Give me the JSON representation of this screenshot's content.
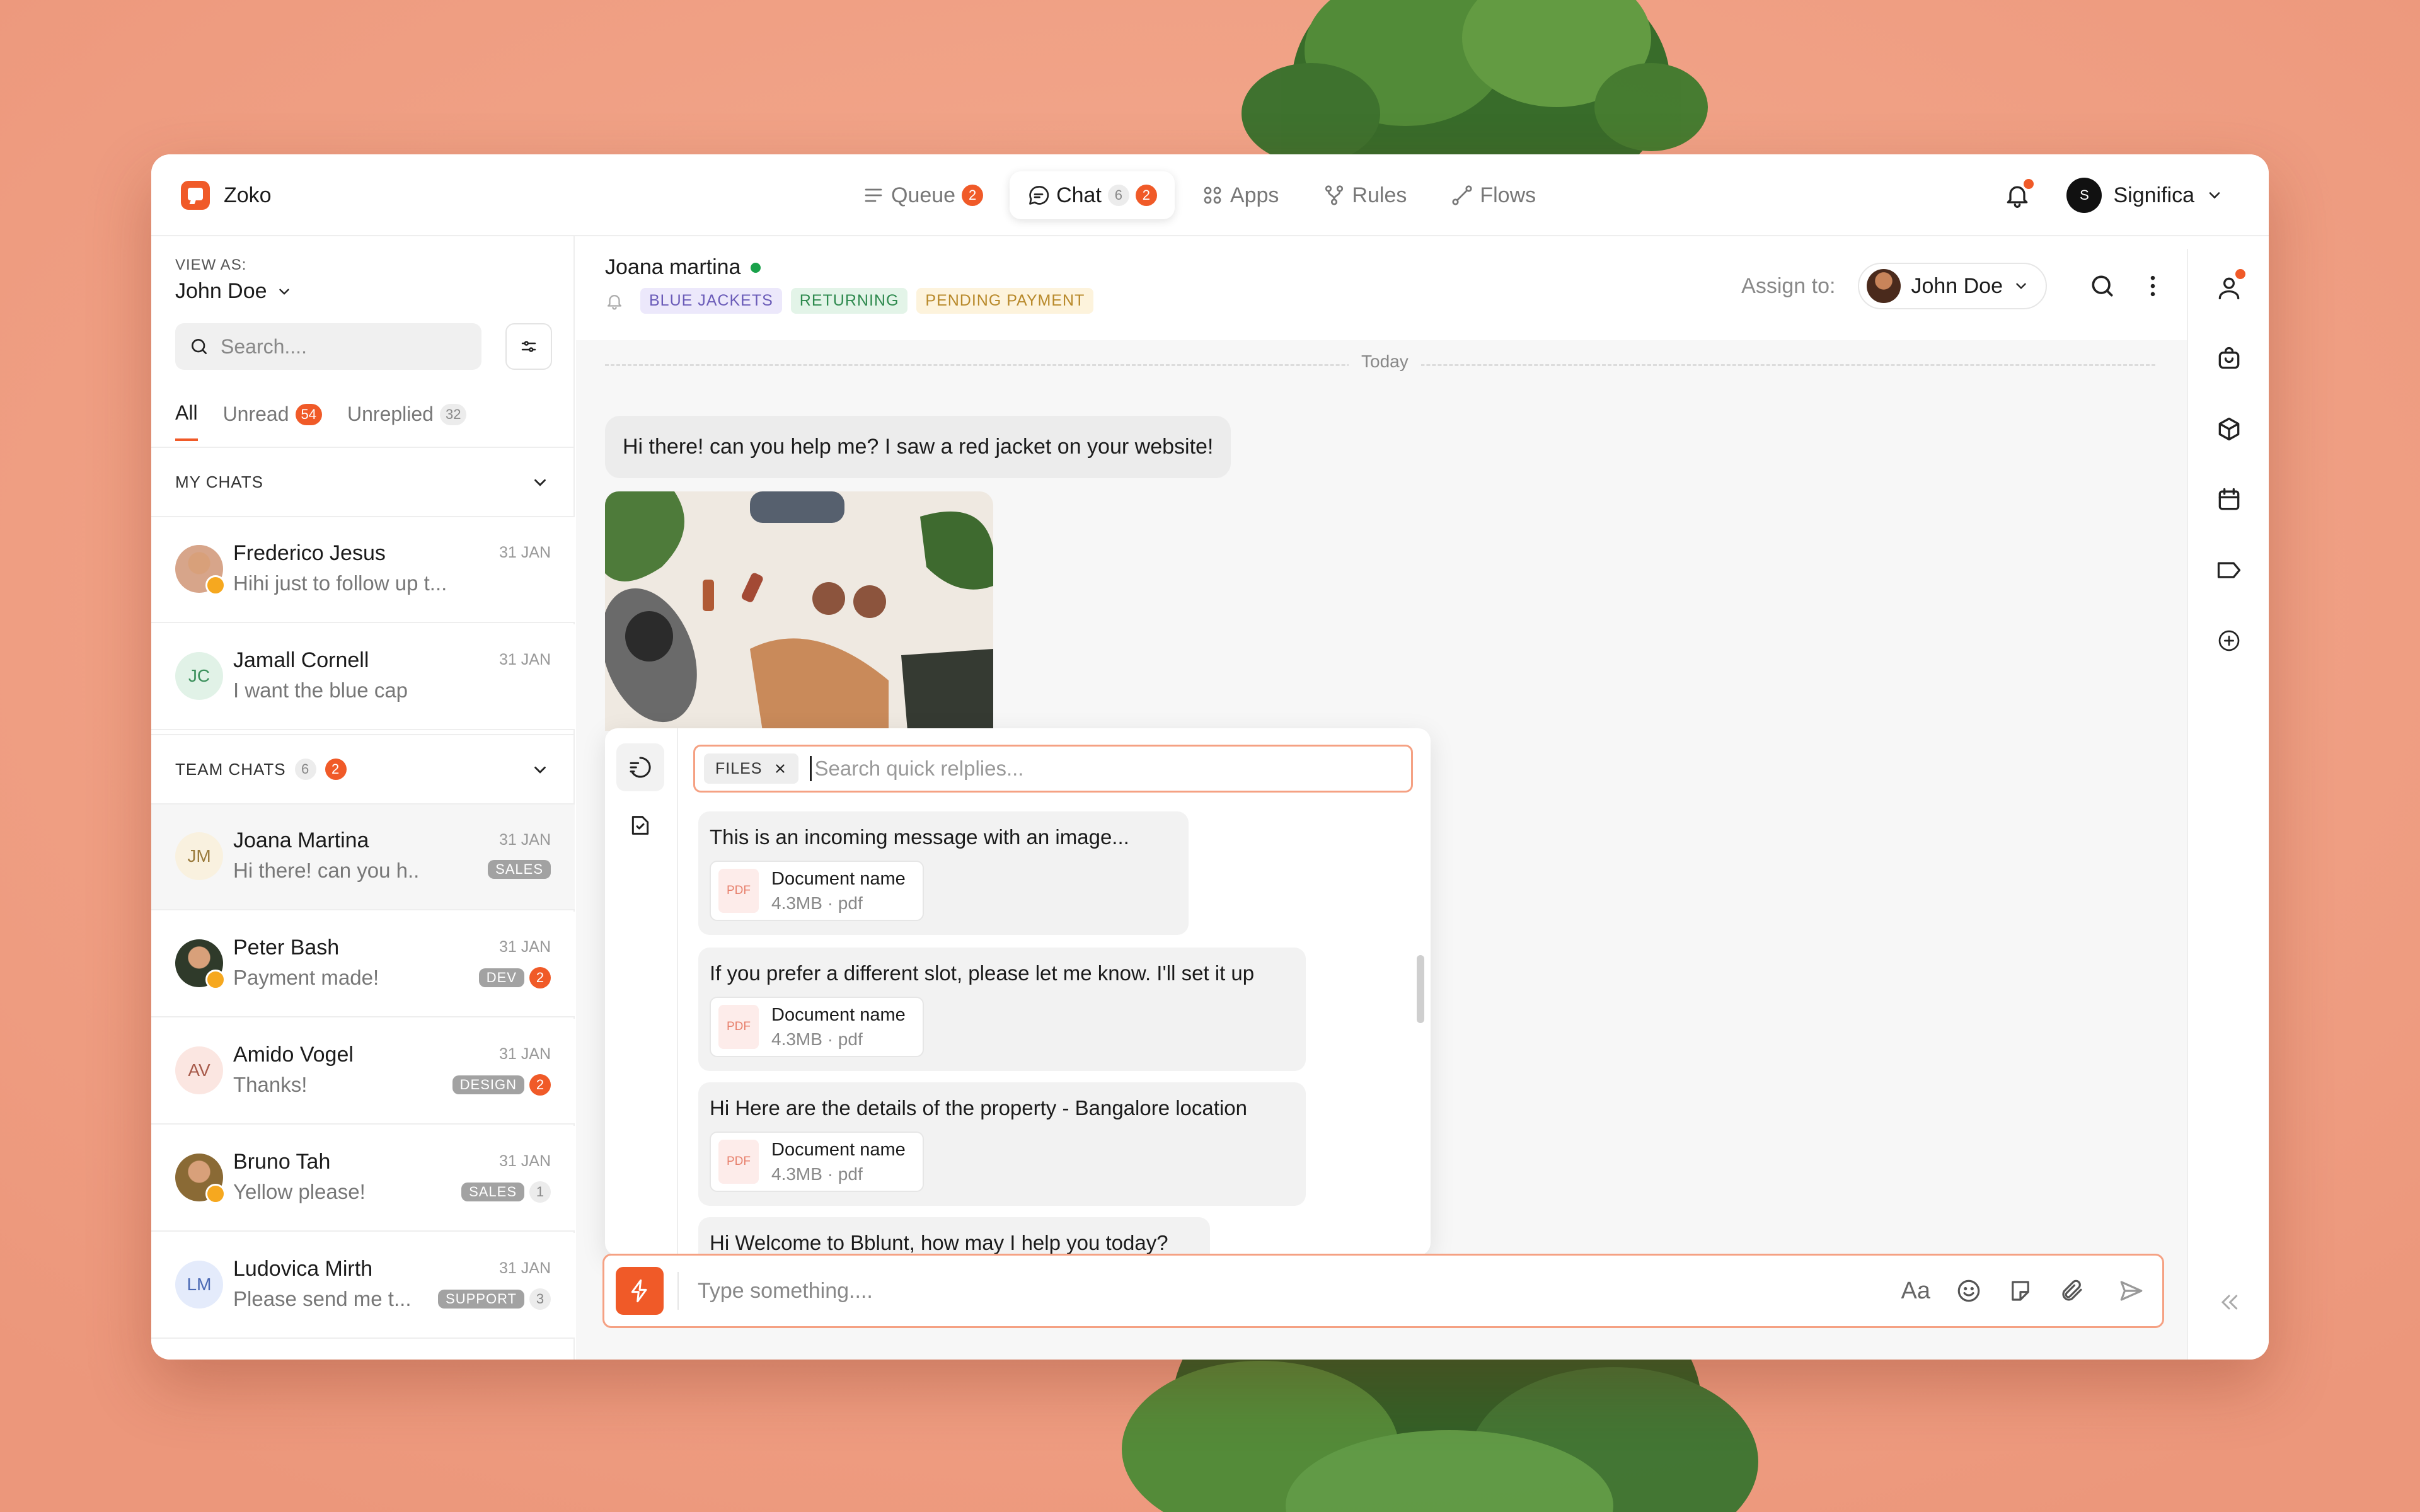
{
  "app": {
    "name": "Zoko"
  },
  "nav": [
    {
      "label": "Queue",
      "icon": "list-icon",
      "badge": "2",
      "active": false
    },
    {
      "label": "Chat",
      "icon": "chat-icon",
      "badge_grey": "6",
      "badge": "2",
      "active": true
    },
    {
      "label": "Apps",
      "icon": "apps-grid-icon",
      "active": false
    },
    {
      "label": "Rules",
      "icon": "rules-icon",
      "active": false
    },
    {
      "label": "Flows",
      "icon": "flows-icon",
      "active": false
    }
  ],
  "org": {
    "avatar": "S",
    "name": "Significa"
  },
  "sidebar": {
    "view_as_label": "VIEW AS:",
    "view_as_value": "John Doe",
    "search_placeholder": "Search....",
    "tabs": [
      {
        "label": "All",
        "count": ""
      },
      {
        "label": "Unread",
        "count": "54"
      },
      {
        "label": "Unreplied",
        "count": "32"
      }
    ],
    "my_chats": {
      "title": "MY CHATS",
      "items": [
        {
          "name": "Frederico Jesus",
          "date": "31 JAN",
          "message": "Hihi just to follow up t...",
          "initials": "",
          "avatar_color": "#d7a58a"
        },
        {
          "name": "Jamall Cornell",
          "date": "31 JAN",
          "message": "I want the blue cap",
          "initials": "JC",
          "avatar_color": "#e1f2e7",
          "initials_color": "#3a8f5a"
        }
      ]
    },
    "team_chats": {
      "title": "TEAM CHATS",
      "count": "6",
      "badge": "2",
      "items": [
        {
          "name": "Joana Martina",
          "date": "31 JAN",
          "message": "Hi there! can you h..",
          "initials": "JM",
          "avatar_color": "#f9f1df",
          "initials_color": "#9a7b3c",
          "label": "SALES",
          "unread": ""
        },
        {
          "name": "Peter Bash",
          "date": "31 JAN",
          "message": "Payment made!",
          "initials": "",
          "avatar_color": "#2f3a2a",
          "label": "DEV",
          "unread": "2"
        },
        {
          "name": "Amido Vogel",
          "date": "31 JAN",
          "message": "Thanks!",
          "initials": "AV",
          "avatar_color": "#fbe6e1",
          "initials_color": "#a75a4a",
          "label": "DESIGN",
          "unread": "2"
        },
        {
          "name": "Bruno Tah",
          "date": "31 JAN",
          "message": "Yellow please!",
          "initials": "",
          "avatar_color": "#8a6a35",
          "label": "SALES",
          "unread_grey": "1"
        },
        {
          "name": "Ludovica Mirth",
          "date": "31 JAN",
          "message": "Please send me t...",
          "initials": "LM",
          "avatar_color": "#e4ebfb",
          "initials_color": "#4a69b4",
          "label": "SUPPORT",
          "unread_grey": "3"
        }
      ]
    }
  },
  "chat": {
    "contact": "Joana martina",
    "tags": [
      {
        "label": "BLUE JACKETS",
        "bg": "#ece8fb",
        "fg": "#6a5bb8"
      },
      {
        "label": "RETURNING",
        "bg": "#e3f4e8",
        "fg": "#2e8a4e"
      },
      {
        "label": "PENDING PAYMENT",
        "bg": "#fdf3dc",
        "fg": "#b8892a"
      }
    ],
    "assign_label": "Assign to:",
    "assignee": "John Doe",
    "divider": "Today",
    "incoming_message": "Hi there! can you help me? I saw a red jacket on your website!",
    "input_placeholder": "Type something....",
    "format_label": "Aa"
  },
  "quick_replies": {
    "filter_chip": "FILES",
    "search_placeholder": "Search quick relplies...",
    "items": [
      {
        "text": "This is an incoming message with an image...",
        "doc_name": "Document name",
        "doc_meta": "4.3MB · pdf"
      },
      {
        "text": "If you prefer a different slot, please let me know. I'll set it up",
        "doc_name": "Document name",
        "doc_meta": "4.3MB · pdf"
      },
      {
        "text": "Hi Here are the details of the property - Bangalore location",
        "doc_name": "Document name",
        "doc_meta": "4.3MB · pdf"
      },
      {
        "text": "Hi Welcome to Bblunt, how may I help you today?"
      }
    ],
    "pdf_label": "PDF"
  },
  "colors": {
    "accent": "#f05a28",
    "background": "#f0a187"
  }
}
